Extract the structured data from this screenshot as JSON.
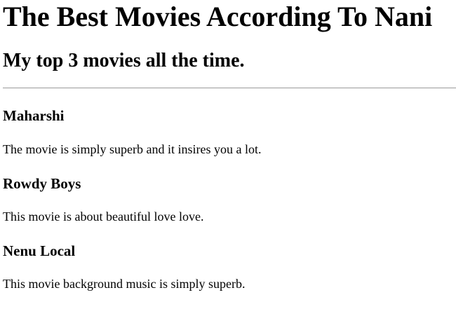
{
  "page": {
    "title": "The Best Movies According To Nani",
    "subtitle": "My top 3 movies all the time."
  },
  "movies": [
    {
      "name": "Maharshi",
      "description": "The movie is simply superb and it insires you a lot."
    },
    {
      "name": "Rowdy Boys",
      "description": "This movie is about beautiful love love."
    },
    {
      "name": "Nenu Local",
      "description": "This movie background music is simply superb."
    }
  ]
}
